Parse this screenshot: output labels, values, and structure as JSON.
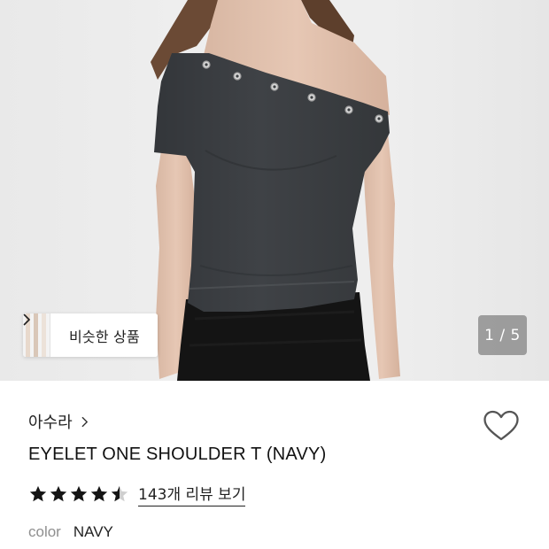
{
  "gallery": {
    "similar_label": "비슷한 상품",
    "counter": "1 / 5"
  },
  "product": {
    "brand": "아수라",
    "title": "EYELET ONE SHOULDER T (NAVY)",
    "rating": 4.5,
    "reviews_link": "143개 리뷰 보기",
    "color_label": "color",
    "color_value": "NAVY"
  },
  "colors": {
    "shirt": "#3d4043",
    "skirt": "#141414",
    "star": "#151515",
    "star_empty": "#cfcfcf",
    "counter_bg": "#6e6e6e"
  },
  "icons": {
    "heart": "heart-outline-icon",
    "chevron": "chevron-right-icon",
    "star": "star-icon"
  }
}
